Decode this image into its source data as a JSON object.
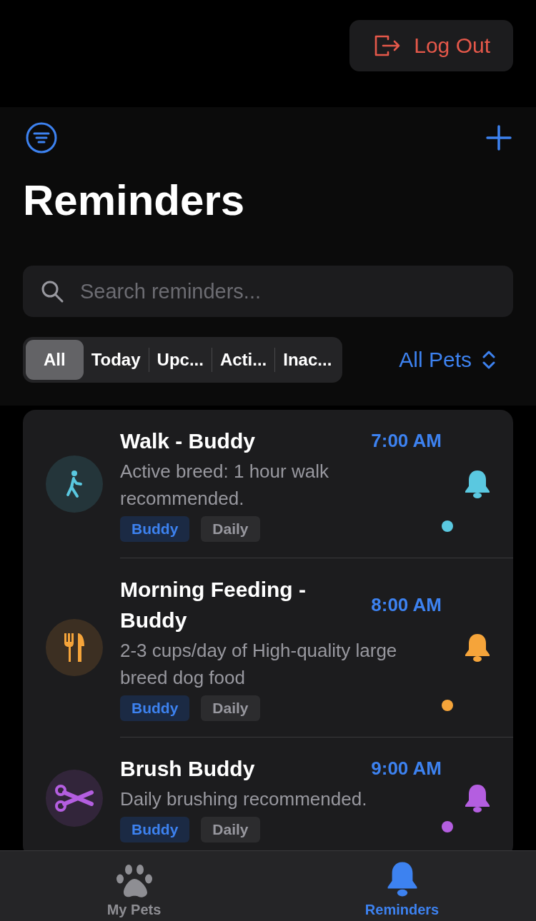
{
  "header": {
    "logout_label": "Log Out"
  },
  "title": "Reminders",
  "search": {
    "placeholder": "Search reminders..."
  },
  "segments": [
    {
      "label": "All",
      "selected": true
    },
    {
      "label": "Today",
      "selected": false
    },
    {
      "label": "Upc...",
      "selected": false
    },
    {
      "label": "Acti...",
      "selected": false
    },
    {
      "label": "Inac...",
      "selected": false
    }
  ],
  "pet_filter": {
    "label": "All Pets"
  },
  "reminders": [
    {
      "kind": "walk",
      "color": "#5ac8e0",
      "title": "Walk - Buddy",
      "time": "7:00 AM",
      "note": "Active breed: 1 hour walk recommended.",
      "tags": [
        {
          "label": "Buddy",
          "kind": "pet"
        },
        {
          "label": "Daily",
          "kind": "frequency"
        }
      ]
    },
    {
      "kind": "food",
      "color": "#f5a43a",
      "title": "Morning Feeding - Buddy",
      "time": "8:00 AM",
      "note": "2-3 cups/day of High-quality large breed dog food",
      "tags": [
        {
          "label": "Buddy",
          "kind": "pet"
        },
        {
          "label": "Daily",
          "kind": "frequency"
        }
      ]
    },
    {
      "kind": "grooming",
      "color": "#b45ee0",
      "title": "Brush Buddy",
      "time": "9:00 AM",
      "note": "Daily brushing recommended.",
      "tags": [
        {
          "label": "Buddy",
          "kind": "pet"
        },
        {
          "label": "Daily",
          "kind": "frequency"
        }
      ]
    }
  ],
  "tab_bar": [
    {
      "label": "My Pets",
      "kind": "pets",
      "selected": false
    },
    {
      "label": "Reminders",
      "kind": "reminders",
      "selected": true
    }
  ]
}
